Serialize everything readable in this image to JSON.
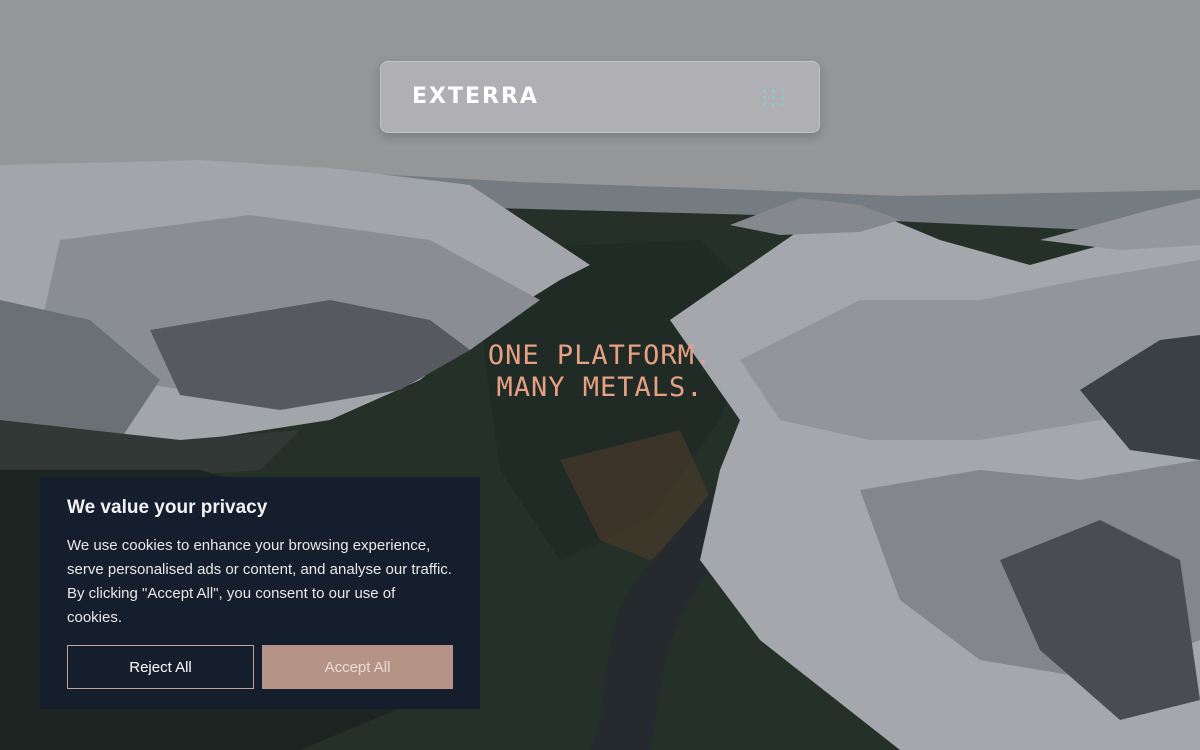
{
  "header": {
    "logo_text": "EXTERRA",
    "menu_icon": "grid-dots-icon"
  },
  "hero": {
    "tagline_line1": "ONE PLATFORM.",
    "tagline_line2": "MANY METALS.",
    "accent_color": "#e6a083"
  },
  "cookie_banner": {
    "title": "We value your privacy",
    "body": "We use cookies to enhance your browsing experience, serve personalised ads or content, and analyse our traffic. By clicking \"Accept All\", you consent to our use of cookies.",
    "reject_label": "Reject All",
    "accept_label": "Accept All",
    "background_color": "#151e2c",
    "accept_color": "#b69387"
  }
}
